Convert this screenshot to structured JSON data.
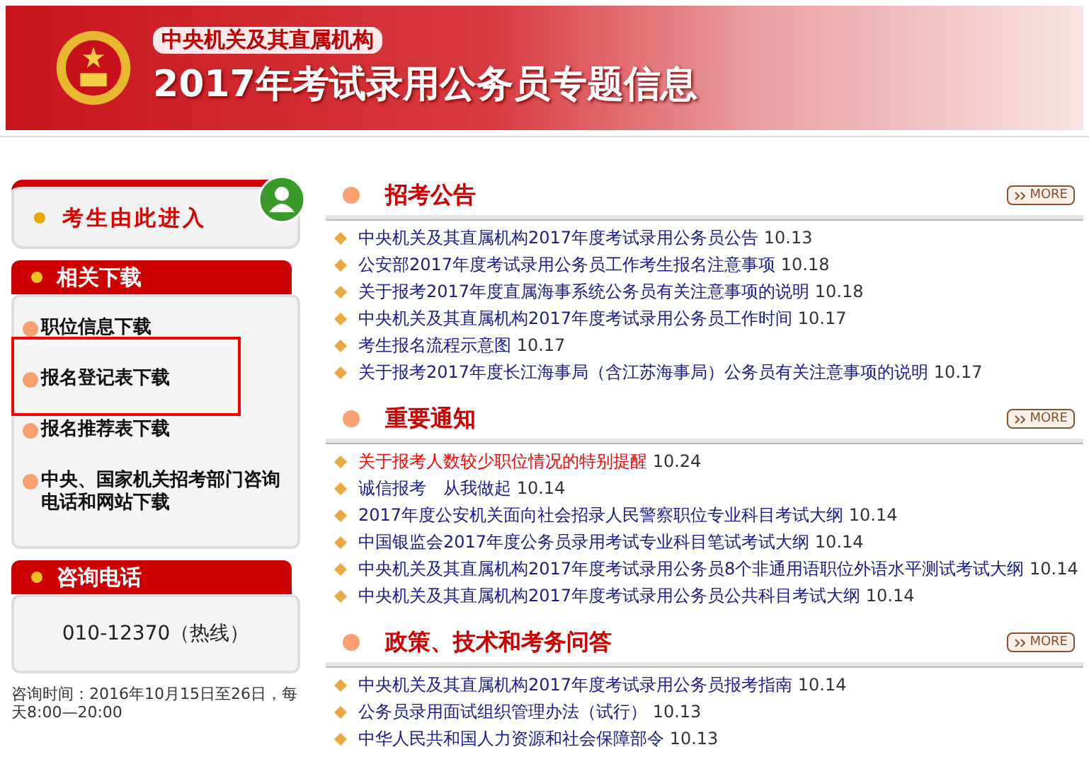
{
  "header": {
    "subtitle": "中央机关及其直属机构",
    "title": "2017年考试录用公务员专题信息"
  },
  "sidebar": {
    "entry": {
      "label": "考生由此进入"
    },
    "downloads": {
      "title": "相关下载",
      "items": [
        {
          "label": "职位信息下载",
          "highlighted": false
        },
        {
          "label": "报名登记表下载",
          "highlighted": true
        },
        {
          "label": "报名推荐表下载",
          "highlighted": false
        },
        {
          "label": "中央、国家机关招考部门咨询电话和网站下载",
          "highlighted": false
        }
      ]
    },
    "hotline": {
      "title": "咨询电话",
      "phone": "010-12370（热线）"
    },
    "hours": "咨询时间：2016年10月15日至26日，每天8:00—20:00"
  },
  "sections": [
    {
      "title": "招考公告",
      "more": "MORE",
      "items": [
        {
          "text": "中央机关及其直属机构2017年度考试录用公务员公告",
          "date": "10.13",
          "urgent": false
        },
        {
          "text": "公安部2017年度考试录用公务员工作考生报名注意事项",
          "date": "10.18",
          "urgent": false
        },
        {
          "text": "关于报考2017年度直属海事系统公务员有关注意事项的说明",
          "date": "10.18",
          "urgent": false
        },
        {
          "text": "中央机关及其直属机构2017年度考试录用公务员工作时间",
          "date": "10.17",
          "urgent": false
        },
        {
          "text": "考生报名流程示意图",
          "date": "10.17",
          "urgent": false
        },
        {
          "text": "关于报考2017年度长江海事局（含江苏海事局）公务员有关注意事项的说明",
          "date": "10.17",
          "urgent": false
        }
      ]
    },
    {
      "title": "重要通知",
      "more": "MORE",
      "items": [
        {
          "text": "关于报考人数较少职位情况的特别提醒",
          "date": "10.24",
          "urgent": true
        },
        {
          "text": "诚信报考　从我做起",
          "date": "10.14",
          "urgent": false
        },
        {
          "text": "2017年度公安机关面向社会招录人民警察职位专业科目考试大纲",
          "date": "10.14",
          "urgent": false
        },
        {
          "text": "中国银监会2017年度公务员录用考试专业科目笔试考试大纲",
          "date": "10.14",
          "urgent": false
        },
        {
          "text": "中央机关及其直属机构2017年度考试录用公务员8个非通用语职位外语水平测试考试大纲",
          "date": "10.14",
          "urgent": false
        },
        {
          "text": "中央机关及其直属机构2017年度考试录用公务员公共科目考试大纲",
          "date": "10.14",
          "urgent": false
        }
      ]
    },
    {
      "title": "政策、技术和考务问答",
      "more": "MORE",
      "items": [
        {
          "text": "中央机关及其直属机构2017年度考试录用公务员报考指南",
          "date": "10.14",
          "urgent": false
        },
        {
          "text": "公务员录用面试组织管理办法（试行）",
          "date": "10.13",
          "urgent": false
        },
        {
          "text": "中华人民共和国人力资源和社会保障部令",
          "date": "10.13",
          "urgent": false
        }
      ]
    }
  ]
}
